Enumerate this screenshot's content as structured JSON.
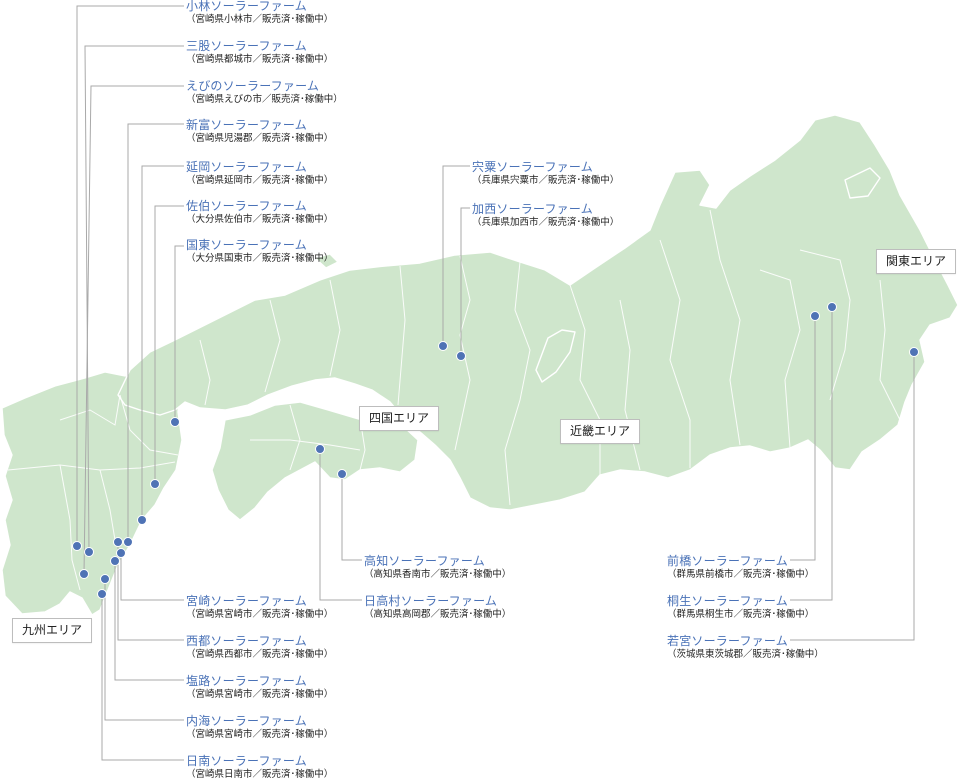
{
  "areas": {
    "kyushu": "九州エリア",
    "shikoku": "四国エリア",
    "kinki": "近畿エリア",
    "kanto": "関東エリア"
  },
  "farms": [
    {
      "name": "小林ソーラーファーム",
      "detail": "（宮崎県小林市／販売済･稼働中）"
    },
    {
      "name": "三股ソーラーファーム",
      "detail": "（宮崎県都城市／販売済･稼働中）"
    },
    {
      "name": "えびのソーラーファーム",
      "detail": "（宮崎県えびの市／販売済･稼働中）"
    },
    {
      "name": "新富ソーラーファーム",
      "detail": "（宮崎県児湯郡／販売済･稼働中）"
    },
    {
      "name": "延岡ソーラーファーム",
      "detail": "（宮崎県延岡市／販売済･稼働中）"
    },
    {
      "name": "佐伯ソーラーファーム",
      "detail": "（大分県佐伯市／販売済･稼働中）"
    },
    {
      "name": "国東ソーラーファーム",
      "detail": "（大分県国東市／販売済･稼働中）"
    },
    {
      "name": "宍粟ソーラーファーム",
      "detail": "（兵庫県宍粟市／販売済･稼働中）"
    },
    {
      "name": "加西ソーラーファーム",
      "detail": "（兵庫県加西市／販売済･稼働中）"
    },
    {
      "name": "高知ソーラーファーム",
      "detail": "（高知県香南市／販売済･稼働中）"
    },
    {
      "name": "日高村ソーラーファーム",
      "detail": "（高知県高岡郡／販売済･稼働中）"
    },
    {
      "name": "前橋ソーラーファーム",
      "detail": "（群馬県前橋市／販売済･稼働中）"
    },
    {
      "name": "桐生ソーラーファーム",
      "detail": "（群馬県桐生市／販売済･稼働中）"
    },
    {
      "name": "若宮ソーラーファーム",
      "detail": "（茨城県東茨城郡／販売済･稼働中）"
    },
    {
      "name": "宮崎ソーラーファーム",
      "detail": "（宮崎県宮崎市／販売済･稼働中）"
    },
    {
      "name": "西都ソーラーファーム",
      "detail": "（宮崎県西都市／販売済･稼働中）"
    },
    {
      "name": "塩路ソーラーファーム",
      "detail": "（宮崎県宮崎市／販売済･稼働中）"
    },
    {
      "name": "内海ソーラーファーム",
      "detail": "（宮崎県宮崎市／販売済･稼働中）"
    },
    {
      "name": "日南ソーラーファーム",
      "detail": "（宮崎県日南市／販売済･稼働中）"
    }
  ],
  "colors": {
    "land": "#cfe6cc",
    "marker": "#4f73b5",
    "farm_name": "#4a72b7",
    "leader_line": "#a9a9a9"
  }
}
